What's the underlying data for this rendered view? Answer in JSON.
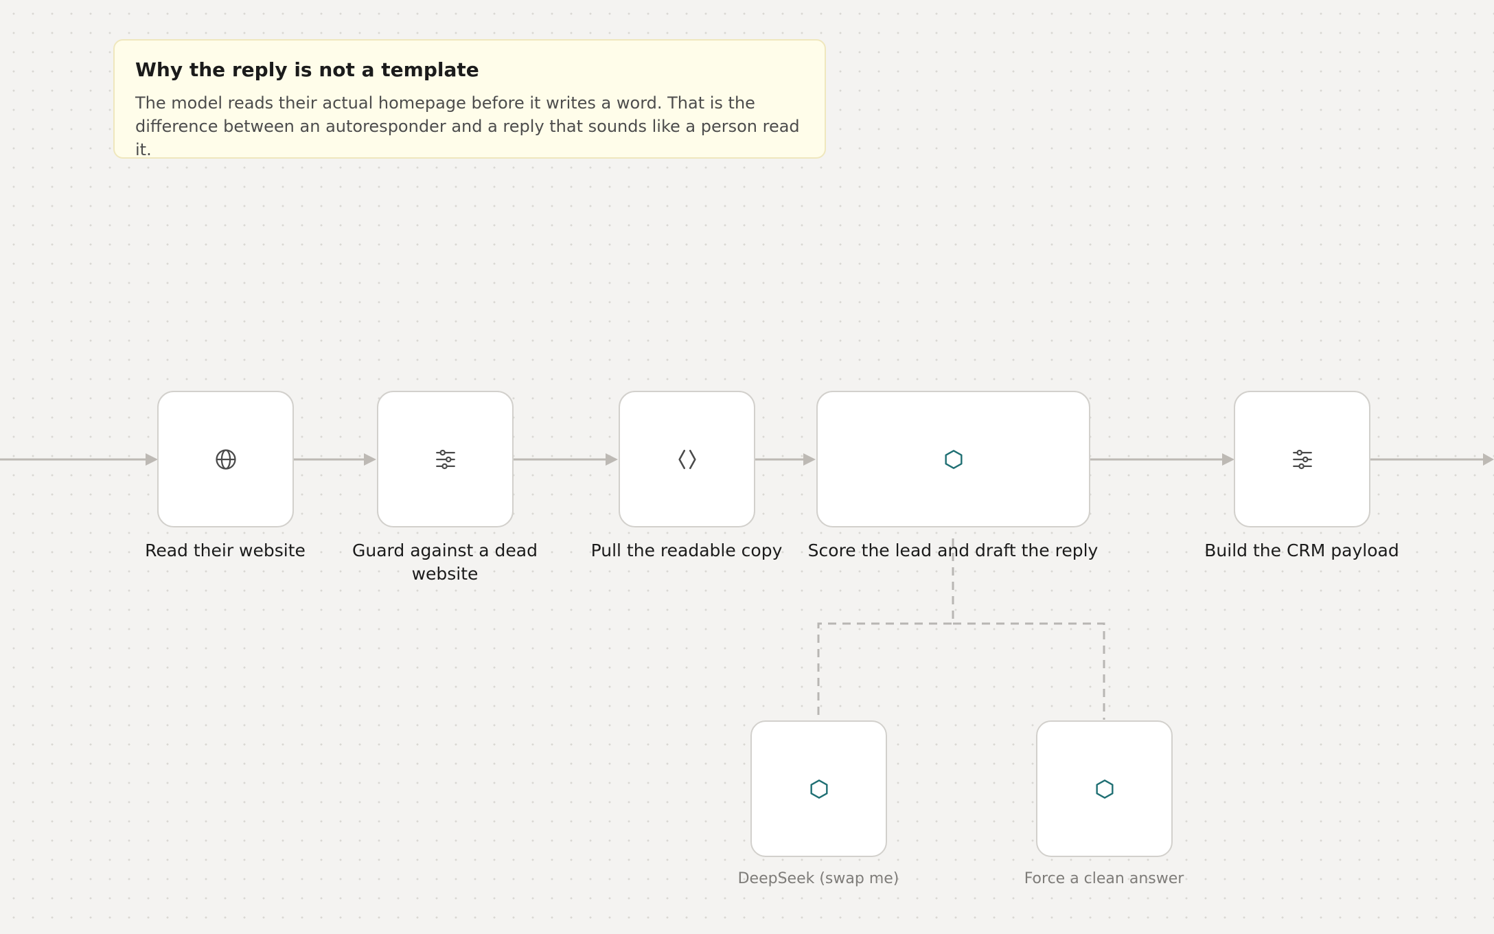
{
  "note": {
    "title": "Why the reply is not a template",
    "body": "The model reads their actual homepage before it writes a word. That is the difference between an autoresponder and a reply that sounds like a person read it."
  },
  "nodes": {
    "read_website": {
      "label": "Read their website",
      "icon": "globe-icon"
    },
    "guard_dead_website": {
      "label": "Guard against a dead website",
      "icon": "sliders-icon"
    },
    "pull_readable_copy": {
      "label": "Pull the readable copy",
      "icon": "code-brackets-icon"
    },
    "score_and_draft": {
      "label": "Score the lead and draft the reply",
      "icon": "hexagon-icon"
    },
    "build_crm_payload": {
      "label": "Build the CRM payload",
      "icon": "sliders-icon"
    },
    "deepseek_model": {
      "label": "DeepSeek (swap me)",
      "icon": "hexagon-icon"
    },
    "output_parser": {
      "label": "Force a clean answer",
      "icon": "hexagon-icon"
    }
  },
  "colors": {
    "canvas": "#f4f3f1",
    "connector": "#bdb9b4",
    "dashed_connector": "#b8b6b3",
    "ai_accent": "#1f6f73",
    "icon": "#4a4a4a",
    "note_bg": "#fffdea"
  }
}
